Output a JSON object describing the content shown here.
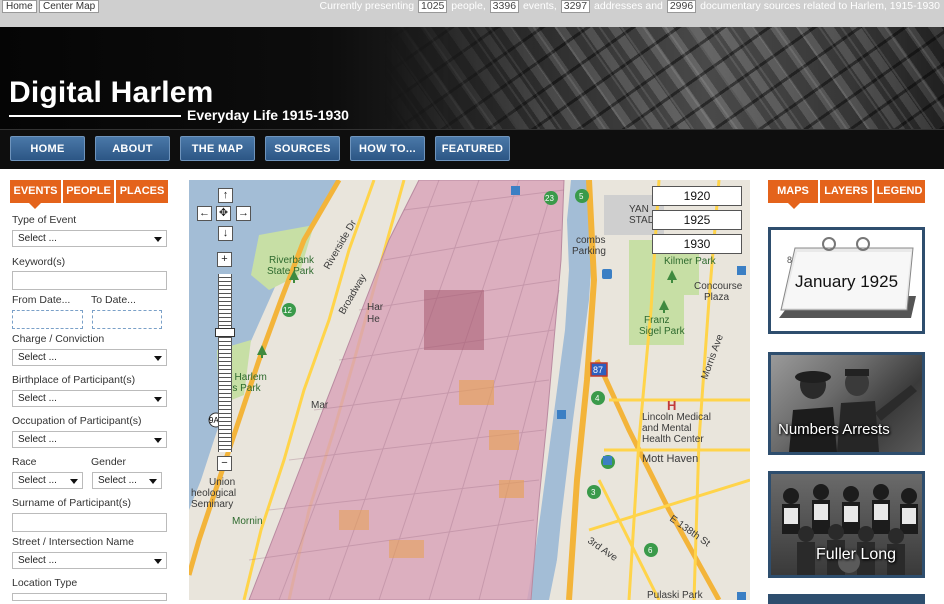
{
  "topbar": {
    "home_label": "Home",
    "center_map_label": "Center Map",
    "stats": {
      "prefix": "Currently presenting",
      "people_count": "1025",
      "people_label": "people,",
      "events_count": "3396",
      "events_label": "events,",
      "addresses_count": "3297",
      "addresses_label": "addresses and",
      "sources_count": "2996",
      "sources_label": "documentary sources related to Harlem, 1915-1930"
    }
  },
  "header": {
    "title": "Digital Harlem",
    "subtitle": "Everyday Life 1915-1930"
  },
  "nav": {
    "items": [
      {
        "label": "HOME"
      },
      {
        "label": "ABOUT"
      },
      {
        "label": "THE MAP"
      },
      {
        "label": "SOURCES"
      },
      {
        "label": "HOW TO..."
      },
      {
        "label": "FEATURED"
      }
    ]
  },
  "left_tabs": [
    "EVENTS",
    "PEOPLE",
    "PLACES"
  ],
  "search_form": {
    "type_of_event_label": "Type of Event",
    "type_of_event_value": "Select ...",
    "keywords_label": "Keyword(s)",
    "from_date_label": "From Date...",
    "to_date_label": "To Date...",
    "charge_label": "Charge / Conviction",
    "charge_value": "Select ...",
    "birthplace_label": "Birthplace of Participant(s)",
    "birthplace_value": "Select ...",
    "occupation_label": "Occupation of Participant(s)",
    "occupation_value": "Select ...",
    "race_label": "Race",
    "race_value": "Select ...",
    "gender_label": "Gender",
    "gender_value": "Select ...",
    "surname_label": "Surname of Participant(s)",
    "street_label": "Street / Intersection Name",
    "street_value": "Select ...",
    "location_type_label": "Location Type"
  },
  "map": {
    "years": [
      "1920",
      "1925",
      "1930"
    ],
    "controls": {
      "pan_up": "↑",
      "pan_left": "←",
      "pan_center": "✥",
      "pan_right": "→",
      "pan_down": "↓",
      "zoom_in": "+",
      "zoom_out": "−"
    },
    "labels": {
      "riverbank": "Riverbank",
      "state_park": "State Park",
      "riverside_dr": "Riverside Dr",
      "broadway": "Broadway",
      "har": "Har",
      "harlem_rivers": "t Harlem",
      "rs_park": "rs Park",
      "mar": "Mar",
      "union": "Union",
      "theological": "heological",
      "seminary": "Seminary",
      "mornin": "Mornin",
      "he": "He",
      "yankee": "YAN",
      "stadium": "STAD",
      "macombs": "combs",
      "parking": "Parking",
      "kilmer": "Kilmer Park",
      "concourse": "Concourse",
      "plaza": "Plaza",
      "franz_sigel": "Franz",
      "sigel_park": "Sigel Park",
      "morris_ave": "Morris Ave",
      "lincoln": "Lincoln Medical",
      "and_mental": "and Mental",
      "health": "Health Center",
      "mott_haven": "Mott Haven",
      "e138": "E 138th St",
      "third_ave": "3rd Ave",
      "pulaski": "Pulaski Park",
      "r87": "87",
      "r9a": "9A",
      "r12": "12",
      "r23": "23",
      "r5": "5",
      "r4": "4",
      "r3": "3",
      "r2": "2",
      "r6": "6"
    }
  },
  "right_tabs": [
    "MAPS",
    "LAYERS",
    "LEGEND"
  ],
  "featured_cards": [
    {
      "caption": "January 1925"
    },
    {
      "caption": "Numbers Arrests"
    },
    {
      "caption": "Fuller Long"
    }
  ],
  "colors": {
    "tab_orange": "#e4631b",
    "nav_blue": "#2c5685",
    "card_border": "#2e4e6e",
    "map_water": "#a3bdd6",
    "map_park": "#c7dfa5",
    "map_road": "#ffd44a",
    "overlay_pink": "#d9a2b8"
  }
}
